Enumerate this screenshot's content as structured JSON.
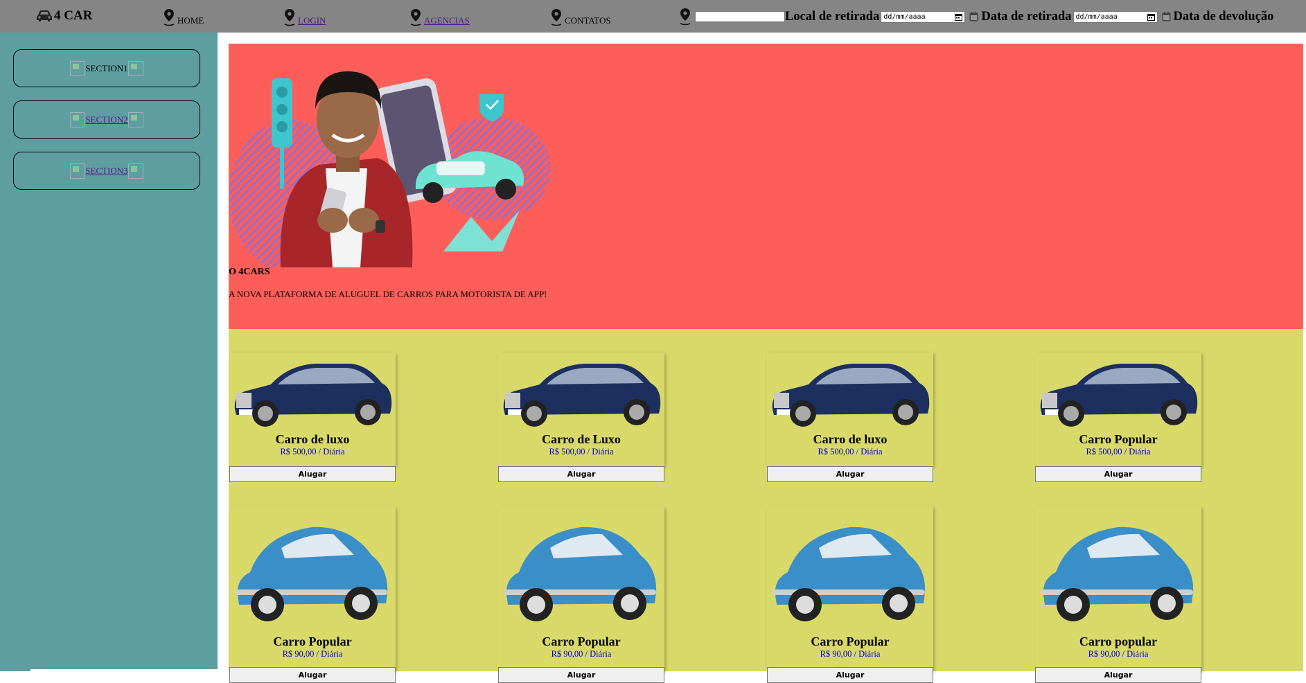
{
  "brand": {
    "name": "4 CAR",
    "icon": "car-icon"
  },
  "nav": [
    {
      "label": "HOME",
      "link": false
    },
    {
      "label": "LOGIN",
      "link": true
    },
    {
      "label": "AGENCIAS",
      "link": true
    },
    {
      "label": "CONTATOS",
      "link": false
    }
  ],
  "search": {
    "pickup_location_label": "Local de retirada",
    "pickup_location_value": "",
    "pickup_date_label": "Data de retirada",
    "pickup_date_placeholder": "dd/mm/aaaa",
    "return_date_label": "Data de devolução",
    "return_date_placeholder": "dd/mm/aaaa"
  },
  "sidebar": {
    "items": [
      {
        "label": "SECTION1",
        "link": false
      },
      {
        "label": "SECTION2",
        "link": true
      },
      {
        "label": "SECTION3",
        "link": true
      }
    ]
  },
  "hero": {
    "title": "O 4CARS",
    "subtitle": "A NOVA PLATAFORMA DE ALUGUEL DE CARROS PARA MOTORISTA DE APP!"
  },
  "products": [
    {
      "name": "Carro de luxo",
      "price": "R$ 500,00 / Diária",
      "button": "Alugar",
      "image": "luxury-sedan"
    },
    {
      "name": "Carro de Luxo",
      "price": "R$ 500,00 / Diária",
      "button": "Alugar",
      "image": "luxury-sedan"
    },
    {
      "name": "Carro de luxo",
      "price": "R$ 500,00 / Diária",
      "button": "Alugar",
      "image": "luxury-sedan"
    },
    {
      "name": "Carro Popular",
      "price": "R$ 500,00 / Diária",
      "button": "Alugar",
      "image": "luxury-sedan"
    },
    {
      "name": "Carro Popular",
      "price": "R$ 90,00 / Diária",
      "button": "Alugar",
      "image": "beetle"
    },
    {
      "name": "Carro Popular",
      "price": "R$ 90,00 / Diária",
      "button": "Alugar",
      "image": "beetle"
    },
    {
      "name": "Carro Popular",
      "price": "R$ 90,00 / Diária",
      "button": "Alugar",
      "image": "beetle"
    },
    {
      "name": "Carro popular",
      "price": "R$ 90,00 / Diária",
      "button": "Alugar",
      "image": "beetle"
    }
  ],
  "colors": {
    "topbar": "#858585",
    "sidebar": "#5f9ea0",
    "hero": "#fe5e5a",
    "products": "#d9d96a",
    "price": "#0000cc",
    "visited_link": "#551a8b"
  }
}
